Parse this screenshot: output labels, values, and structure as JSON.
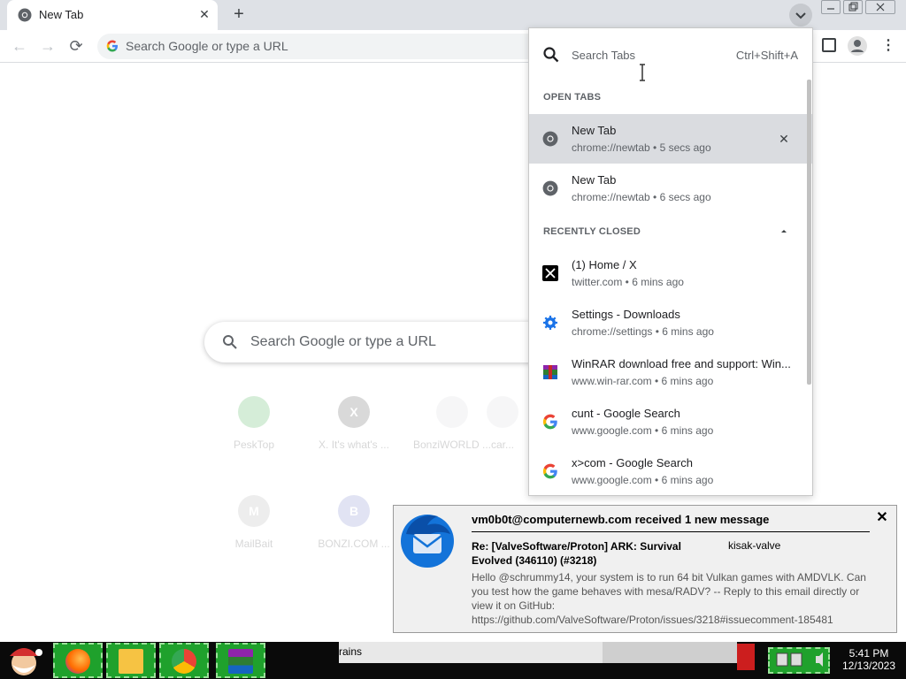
{
  "browser": {
    "tab": {
      "title": "New Tab",
      "close": "✕"
    },
    "new_tab_glyph": "+",
    "omnibox": {
      "placeholder": "Search Google or type a URL"
    },
    "nav": {
      "back": "←",
      "forward": "→",
      "reload": "⟳"
    },
    "menu_glyph": "⋮"
  },
  "ntp": {
    "search_placeholder": "Search Google or type a URL",
    "shortcuts": [
      {
        "label": "PeskTop",
        "glyph": ""
      },
      {
        "label": "X. It's what's ...",
        "glyph": "X"
      },
      {
        "label": "BonziWORLD ...",
        "glyph": ""
      },
      {
        "label": "car...",
        "glyph": ""
      },
      {
        "label": "MailBait",
        "glyph": "M"
      },
      {
        "label": "BONZI.COM ...",
        "glyph": "B"
      }
    ]
  },
  "tab_search": {
    "placeholder": "Search Tabs",
    "shortcut": "Ctrl+Shift+A",
    "open_tabs_header": "OPEN TABS",
    "recently_closed_header": "RECENTLY CLOSED",
    "open_tabs": [
      {
        "title": "New Tab",
        "subtitle": "chrome://newtab • 5 secs ago",
        "icon": "chrome-icon"
      },
      {
        "title": "New Tab",
        "subtitle": "chrome://newtab • 6 secs ago",
        "icon": "chrome-icon"
      }
    ],
    "recently_closed": [
      {
        "title": "(1) Home / X",
        "subtitle": "twitter.com • 6 mins ago",
        "icon": "x-icon"
      },
      {
        "title": "Settings - Downloads",
        "subtitle": "chrome://settings • 6 mins ago",
        "icon": "gear-icon"
      },
      {
        "title": "WinRAR download free and support: Win...",
        "subtitle": "www.win-rar.com • 6 mins ago",
        "icon": "winrar-icon"
      },
      {
        "title": "cunt - Google Search",
        "subtitle": "www.google.com • 6 mins ago",
        "icon": "google-icon"
      },
      {
        "title": "x>com - Google Search",
        "subtitle": "www.google.com • 6 mins ago",
        "icon": "google-icon"
      }
    ],
    "close_glyph": "✕"
  },
  "notification": {
    "header": "vm0b0t@computernewb.com received 1 new message",
    "subject": "Re: [ValveSoftware/Proton] ARK: Survival Evolved (346110) (#3218)",
    "from": "kisak-valve",
    "body": "Hello @schrummy14, your system is to run 64 bit Vulkan games with AMDVLK. Can you test how the game behaves with mesa/RADV? -- Reply to this email directly or view it on GitHub: https://github.com/ValveSoftware/Proton/issues/3218#issuecomment-185481",
    "close": "✕"
  },
  "taskbar": {
    "strip_text": "rains",
    "time": "5:41 PM",
    "date": "12/13/2023"
  },
  "colors": {
    "accent": "#1a73e8",
    "taskbar_green": "#1fa12c"
  }
}
